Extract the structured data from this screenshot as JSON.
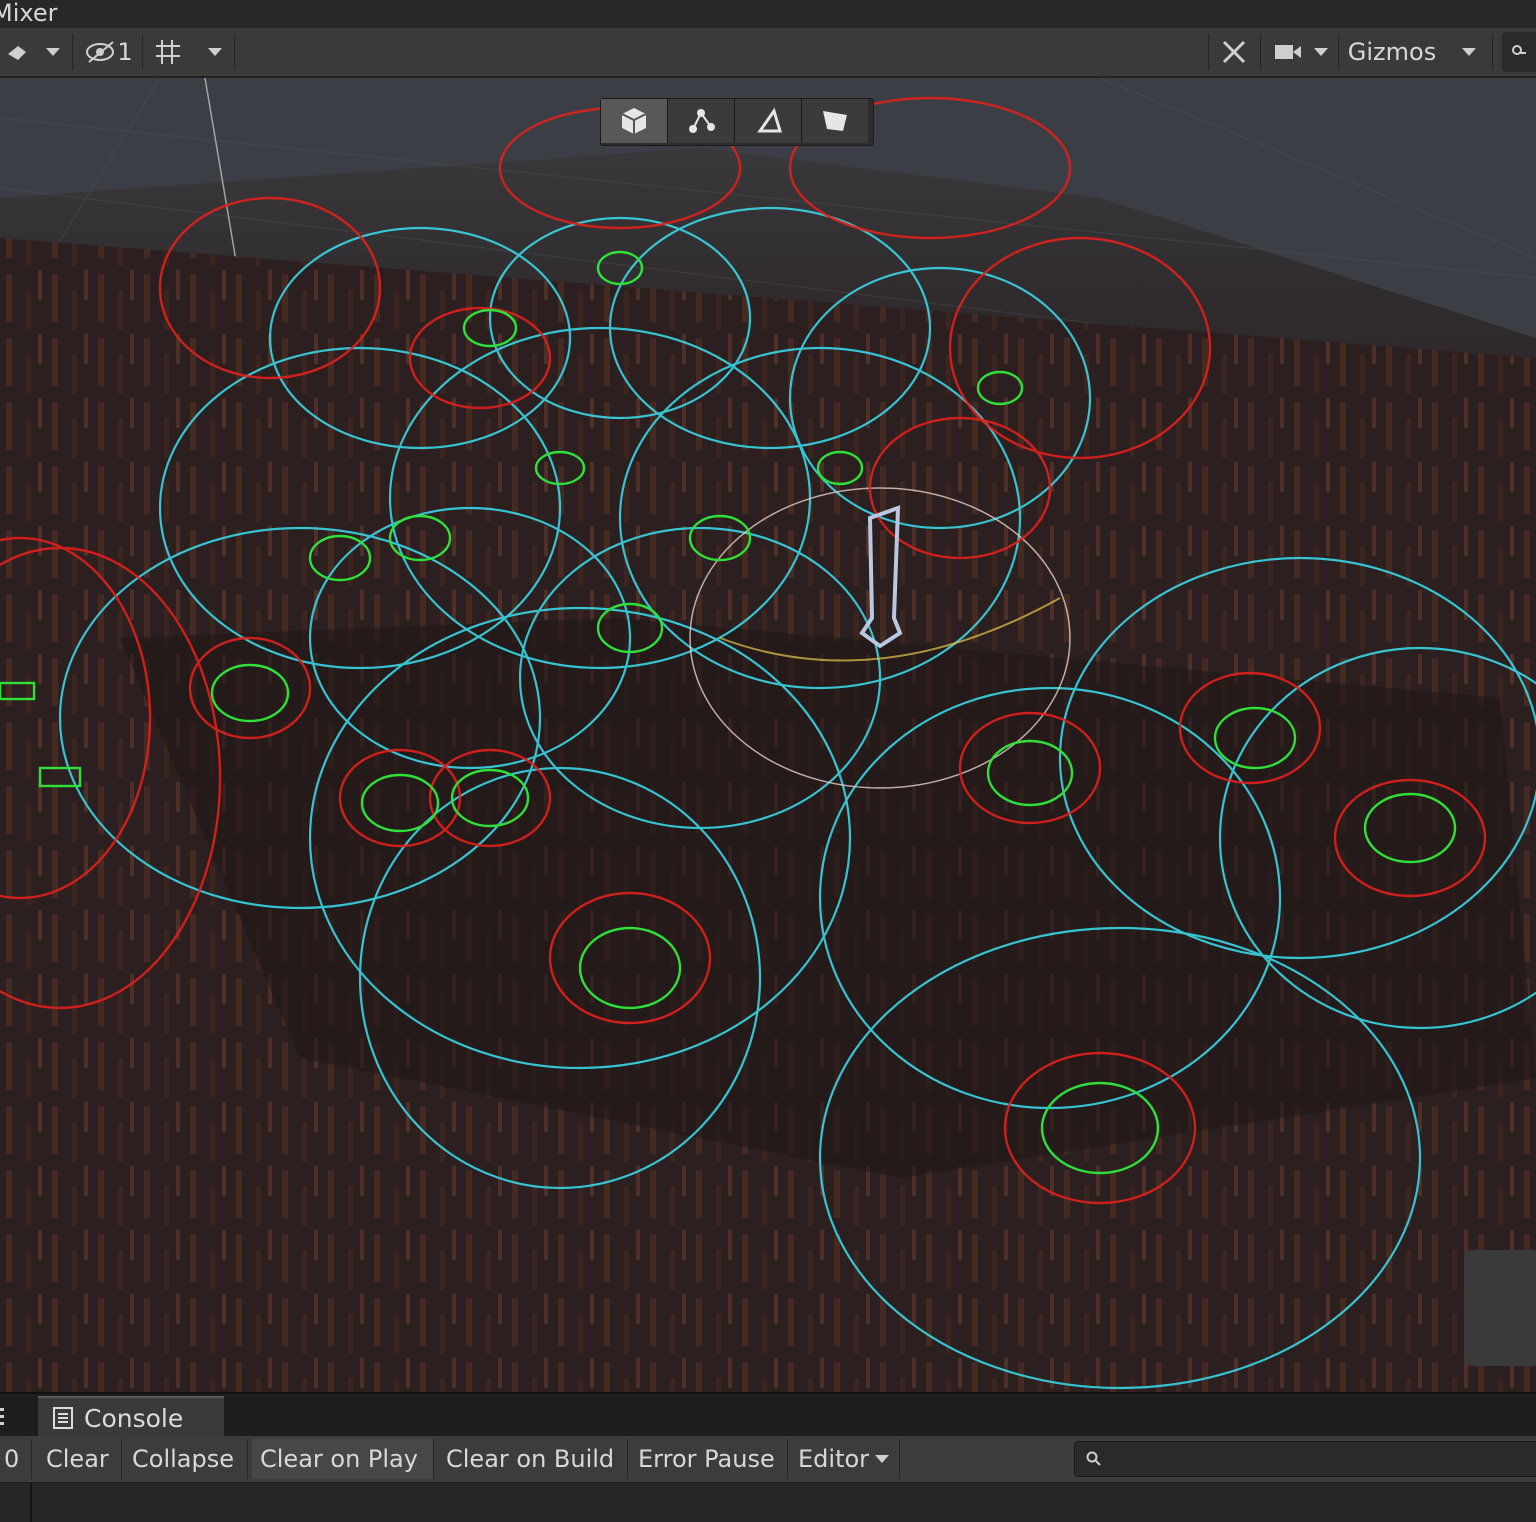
{
  "window": {
    "tab_title": "Mixer"
  },
  "scene_toolbar": {
    "hidden_count": "1",
    "gizmos_label": "Gizmos"
  },
  "console": {
    "tab_label": "Console",
    "count": "0",
    "buttons": {
      "clear": "Clear",
      "collapse": "Collapse",
      "clear_on_play": "Clear on Play",
      "clear_on_build": "Clear on Build",
      "error_pause": "Error Pause",
      "editor": "Editor"
    },
    "search_placeholder": ""
  },
  "colors": {
    "trigger_sphere": "#39d6e6",
    "danger_sphere": "#e0201c",
    "agent_gizmo": "#2fe03a",
    "scene_ground": "#2b2021"
  }
}
